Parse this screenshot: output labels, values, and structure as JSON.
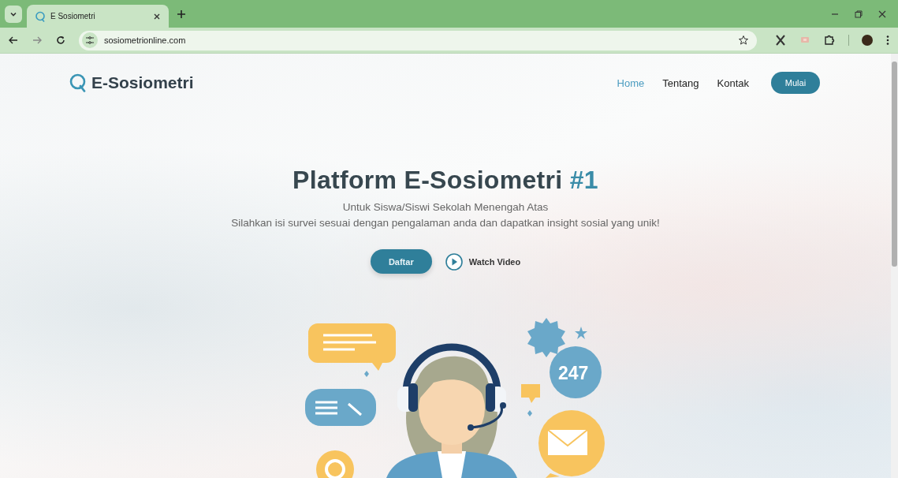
{
  "browser": {
    "tab_title": "E Sosiometri",
    "address": "sosiometrionline.com"
  },
  "nav": {
    "brand": "E-Sosiometri",
    "links": [
      {
        "label": "Home",
        "selected": true
      },
      {
        "label": "Tentang",
        "selected": false
      },
      {
        "label": "Kontak",
        "selected": false
      }
    ],
    "cta": "Mulai"
  },
  "hero": {
    "title": "Platform E-Sosiometri",
    "title_accent": "#1",
    "subtitle": "Untuk Siswa/Siswi Sekolah Menengah Atas",
    "description": "Silahkan isi survei sesuai dengan pengalaman anda dan dapatkan insight sosial yang unik!",
    "primary_button": "Daftar",
    "video_link": "Watch Video"
  },
  "illustration": {
    "badge": "247"
  }
}
